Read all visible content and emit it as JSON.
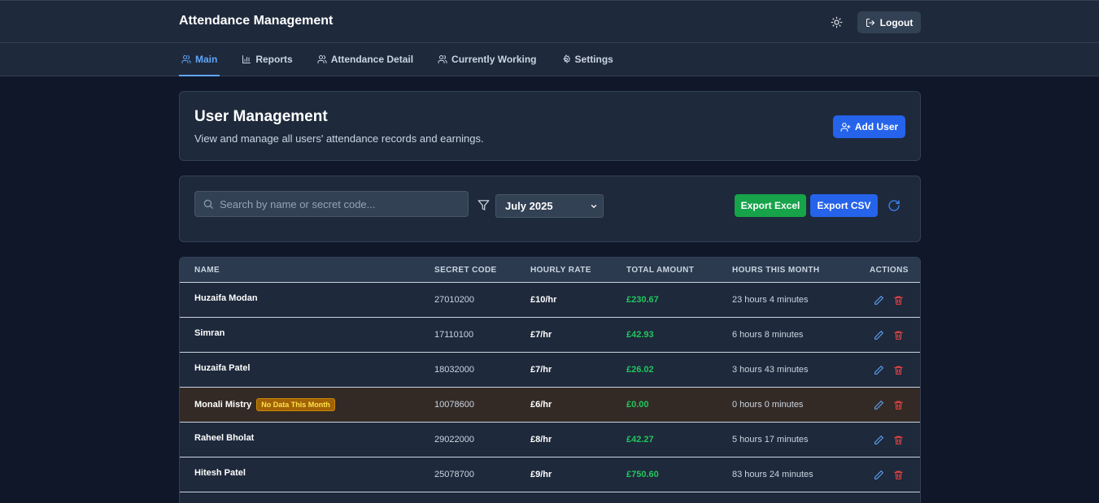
{
  "app": {
    "title": "Attendance Management",
    "logout_label": "Logout"
  },
  "nav": {
    "tabs": [
      {
        "label": "Main",
        "icon": "users-icon",
        "active": true
      },
      {
        "label": "Reports",
        "icon": "bar-chart-icon",
        "active": false
      },
      {
        "label": "Attendance Detail",
        "icon": "users-icon",
        "active": false
      },
      {
        "label": "Currently Working",
        "icon": "users-icon",
        "active": false
      },
      {
        "label": "Settings",
        "icon": "gear-icon",
        "active": false
      }
    ]
  },
  "header": {
    "title": "User Management",
    "subtitle": "View and manage all users' attendance records and earnings.",
    "add_user_label": "Add User"
  },
  "filters": {
    "search_placeholder": "Search by name or secret code...",
    "month_value": "July 2025",
    "export_excel_label": "Export Excel",
    "export_csv_label": "Export CSV"
  },
  "table": {
    "columns": [
      "NAME",
      "SECRET CODE",
      "HOURLY RATE",
      "TOTAL AMOUNT",
      "HOURS THIS MONTH",
      "ACTIONS"
    ],
    "rows": [
      {
        "name": "Huzaifa Modan",
        "badge": "",
        "code": "27010200",
        "rate": "£10/hr",
        "amount": "£230.67",
        "hours": "23 hours 4 minutes"
      },
      {
        "name": "Simran",
        "badge": "",
        "code": "17110100",
        "rate": "£7/hr",
        "amount": "£42.93",
        "hours": "6 hours 8 minutes"
      },
      {
        "name": "Huzaifa Patel",
        "badge": "",
        "code": "18032000",
        "rate": "£7/hr",
        "amount": "£26.02",
        "hours": "3 hours 43 minutes"
      },
      {
        "name": "Monali Mistry",
        "badge": "No Data This Month",
        "code": "10078600",
        "rate": "£6/hr",
        "amount": "£0.00",
        "hours": "0 hours 0 minutes"
      },
      {
        "name": "Raheel Bholat",
        "badge": "",
        "code": "29022000",
        "rate": "£8/hr",
        "amount": "£42.27",
        "hours": "5 hours 17 minutes"
      },
      {
        "name": "Hitesh Patel",
        "badge": "",
        "code": "25078700",
        "rate": "£9/hr",
        "amount": "£750.60",
        "hours": "83 hours 24 minutes"
      }
    ]
  },
  "colors": {
    "background": "#0f1729",
    "panel": "#1e293b",
    "accent_blue": "#2563eb",
    "accent_green": "#16a34a",
    "amount_green": "#22c55e",
    "delete_red": "#ef4444",
    "badge": "#a16207"
  }
}
